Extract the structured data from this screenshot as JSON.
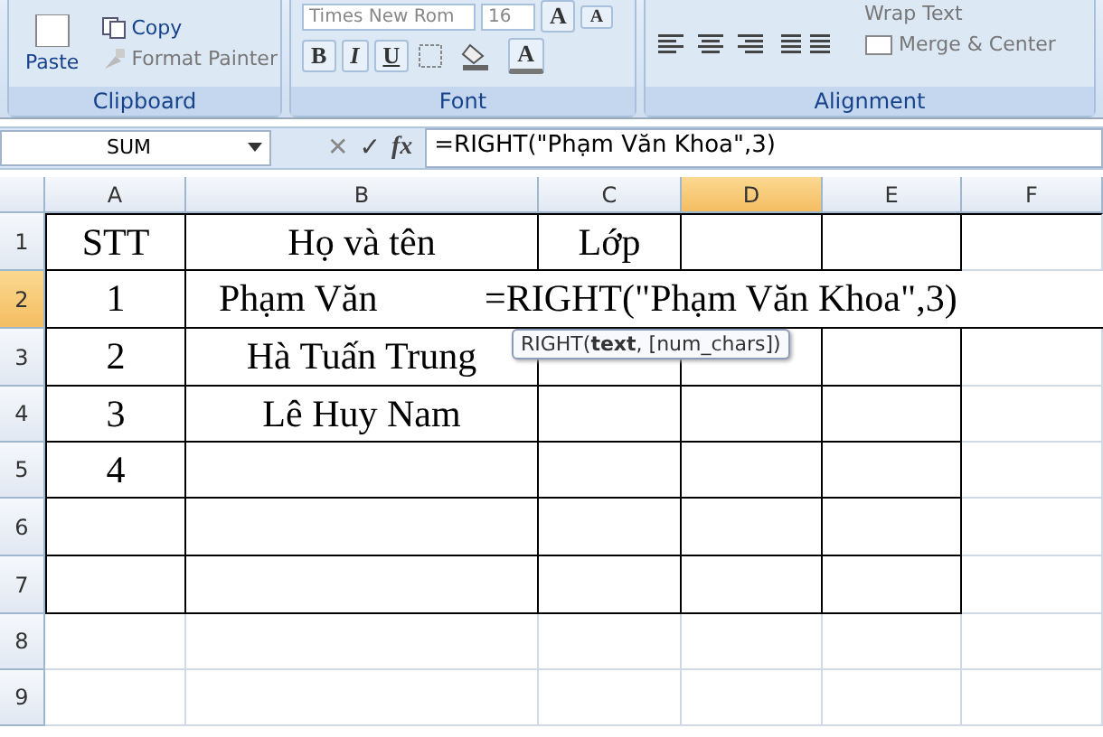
{
  "ribbon": {
    "clipboard": {
      "paste": "Paste",
      "copy": "Copy",
      "format_painter": "Format Painter",
      "title": "Clipboard"
    },
    "font": {
      "font_name": "Times New Rom",
      "font_size": "16",
      "grow": "A",
      "shrink": "A",
      "bold": "B",
      "italic": "I",
      "underline": "U",
      "font_color": "A",
      "title": "Font"
    },
    "alignment": {
      "wrap_text": "Wrap Text",
      "merge": "Merge & Center",
      "title": "Alignment"
    }
  },
  "formula_bar": {
    "name_box": "SUM",
    "cancel": "✕",
    "enter": "✓",
    "function": "fx",
    "formula": "=RIGHT(\"Phạm Văn Khoa\",3)"
  },
  "sheet": {
    "columns": [
      {
        "label": "A",
        "selected": false
      },
      {
        "label": "B",
        "selected": false
      },
      {
        "label": "C",
        "selected": false
      },
      {
        "label": "D",
        "selected": true
      },
      {
        "label": "E",
        "selected": false
      },
      {
        "label": "F",
        "selected": false
      }
    ],
    "rows": [
      {
        "label": "1",
        "selected": false,
        "cells": [
          "STT",
          "Họ và tên",
          "Lớp",
          "",
          "",
          ""
        ]
      },
      {
        "label": "2",
        "selected": true,
        "cells": [
          "1",
          "Phạm Văn"
        ],
        "editing": "=RIGHT(\"Phạm Văn Khoa\",3)"
      },
      {
        "label": "3",
        "selected": false,
        "cells": [
          "2",
          "Hà Tuấn Trung",
          "",
          "",
          "",
          ""
        ]
      },
      {
        "label": "4",
        "selected": false,
        "cells": [
          "3",
          "Lê Huy Nam",
          "",
          "",
          "",
          ""
        ]
      },
      {
        "label": "5",
        "selected": false,
        "cells": [
          "4",
          "",
          "",
          "",
          "",
          ""
        ]
      },
      {
        "label": "6",
        "selected": false,
        "cells": [
          "",
          "",
          "",
          "",
          "",
          ""
        ]
      },
      {
        "label": "7",
        "selected": false,
        "cells": [
          "",
          "",
          "",
          "",
          "",
          ""
        ]
      },
      {
        "label": "8",
        "selected": false,
        "cells": [
          "",
          "",
          "",
          "",
          "",
          ""
        ]
      },
      {
        "label": "9",
        "selected": false,
        "cells": [
          "",
          "",
          "",
          "",
          "",
          ""
        ]
      }
    ],
    "tooltip": "RIGHT(**text**, [num_chars])"
  }
}
